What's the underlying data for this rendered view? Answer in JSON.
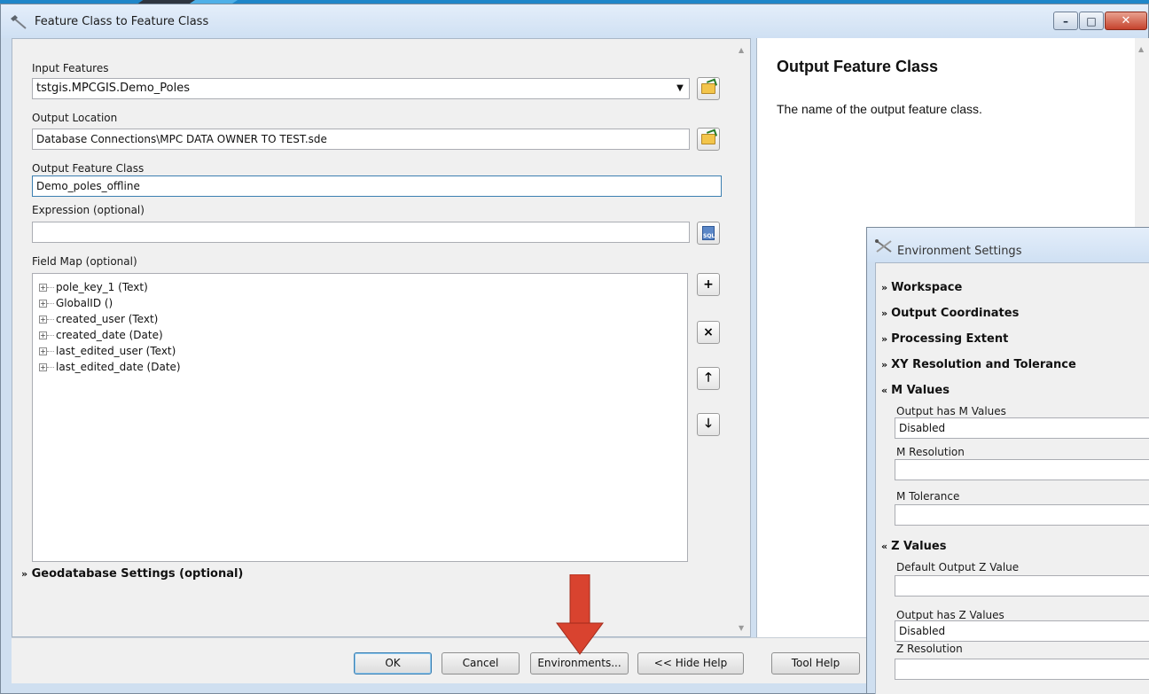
{
  "main_window": {
    "title": "Feature Class to Feature Class",
    "controls": {
      "minimize": "–",
      "maximize": "□",
      "close": "✕"
    }
  },
  "form": {
    "input_features": {
      "label": "Input Features",
      "value": "tstgis.MPCGIS.Demo_Poles"
    },
    "output_location": {
      "label": "Output Location",
      "value": "Database Connections\\MPC DATA OWNER TO TEST.sde"
    },
    "output_feature_class": {
      "label": "Output Feature Class",
      "value": "Demo_poles_offline"
    },
    "expression": {
      "label": "Expression (optional)",
      "value": ""
    },
    "field_map": {
      "label": "Field Map (optional)",
      "items": [
        "pole_key_1 (Text)",
        "GlobalID ()",
        "created_user (Text)",
        "created_date (Date)",
        "last_edited_user (Text)",
        "last_edited_date (Date)"
      ],
      "buttons": {
        "add": "+",
        "remove": "×",
        "up": "🡑",
        "down": "🡓"
      }
    },
    "geodatabase_settings": "Geodatabase Settings (optional)"
  },
  "help": {
    "title": "Output Feature Class",
    "body": "The name of the output feature class."
  },
  "buttons": {
    "ok": "OK",
    "cancel": "Cancel",
    "environments": "Environments...",
    "hide_help": "<< Hide Help",
    "tool_help": "Tool Help"
  },
  "environment_window": {
    "title": "Environment Settings",
    "sections": {
      "workspace": "Workspace",
      "output_coordinates": "Output Coordinates",
      "processing_extent": "Processing Extent",
      "xy_resolution": "XY Resolution and Tolerance",
      "m_values": "M Values",
      "z_values": "Z Values"
    },
    "m_values": {
      "output_has_m_label": "Output has M Values",
      "output_has_m_value": "Disabled",
      "m_resolution_label": "M Resolution",
      "m_resolution_value": "",
      "m_tolerance_label": "M Tolerance",
      "m_tolerance_value": ""
    },
    "z_values": {
      "default_z_label": "Default Output Z Value",
      "default_z_value": "",
      "output_has_z_label": "Output has Z Values",
      "output_has_z_value": "Disabled",
      "z_resolution_label": "Z Resolution",
      "z_resolution_value": ""
    }
  },
  "colors": {
    "annotation_arrow": "#d9432f",
    "title_bar": "#dce8f6",
    "close_button": "#c7442e"
  }
}
